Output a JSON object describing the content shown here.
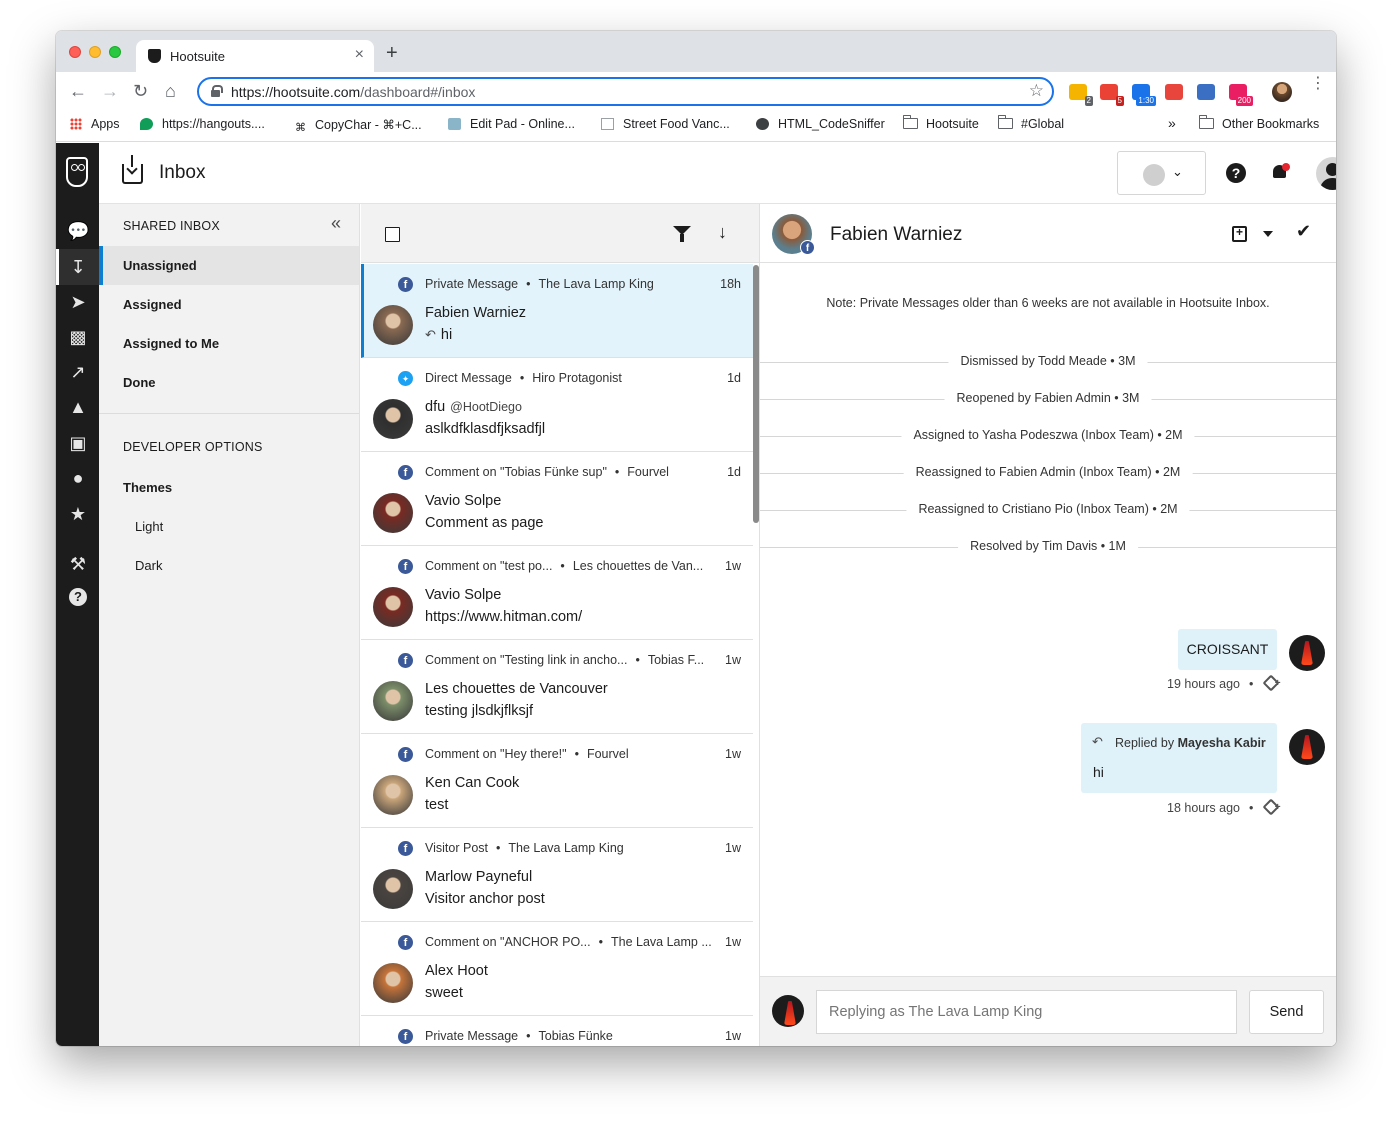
{
  "browser": {
    "tab_title": "Hootsuite",
    "tab_close": "×",
    "new_tab": "+",
    "url_host": "https://hootsuite.com",
    "url_path": "/dashboard#/inbox",
    "extensions": [
      {
        "name": "sticky-notes-ext",
        "color": "#f4b400",
        "badge": "2",
        "badge_color": "#5f6368"
      },
      {
        "name": "gmail-ext",
        "color": "#ea4335",
        "badge": "5",
        "badge_color": "#c5221f"
      },
      {
        "name": "calendar-ext",
        "color": "#1a73e8",
        "badge": "1:30",
        "badge_color": "#1a73e8"
      },
      {
        "name": "timer-ext",
        "color": "#e8453c",
        "badge": "",
        "badge_color": "#e8453c"
      },
      {
        "name": "blue-square-ext",
        "color": "#3b6fc4",
        "badge": "",
        "badge_color": "#3b6fc4"
      },
      {
        "name": "counter-ext",
        "color": "#e91e63",
        "badge": "200",
        "badge_color": "#e91e63"
      }
    ],
    "bookmarks": [
      {
        "label": "Apps",
        "icon": "apps-grid-icon"
      },
      {
        "label": "https://hangouts....",
        "icon": "hangouts-icon"
      },
      {
        "label": "CopyChar - ⌘+C...",
        "icon": "command-icon"
      },
      {
        "label": "Edit Pad - Online...",
        "icon": "notepad-icon"
      },
      {
        "label": "Street Food Vanc...",
        "icon": "cube-icon"
      },
      {
        "label": "HTML_CodeSniffer",
        "icon": "globe-icon"
      },
      {
        "label": "Hootsuite",
        "icon": "folder-icon"
      },
      {
        "label": "#Global",
        "icon": "folder-icon"
      }
    ],
    "overflow": "»",
    "other_bookmarks": "Other Bookmarks"
  },
  "app": {
    "page_title": "Inbox",
    "help": "?",
    "account_chevron": "⌄"
  },
  "sidebar": {
    "heading": "SHARED INBOX",
    "collapse": "«",
    "items": [
      {
        "label": "Unassigned",
        "active": true
      },
      {
        "label": "Assigned",
        "active": false
      },
      {
        "label": "Assigned to Me",
        "active": false
      },
      {
        "label": "Done",
        "active": false
      }
    ],
    "dev_heading": "DEVELOPER OPTIONS",
    "themes_label": "Themes",
    "themes": [
      "Light",
      "Dark"
    ]
  },
  "messages": [
    {
      "network": "facebook",
      "type": "Private Message",
      "source": "The Lava Lamp King",
      "time": "18h",
      "name": "Fabien Warniez",
      "handle": "",
      "text": "hi",
      "replied": true,
      "selected": true,
      "avatar_color": "#8a6a52"
    },
    {
      "network": "twitter",
      "type": "Direct Message",
      "source": "Hiro Protagonist",
      "time": "1d",
      "name": "dfu",
      "handle": "@HootDiego",
      "text": "aslkdfklasdfjksadfjl",
      "replied": false,
      "selected": false,
      "avatar_color": "#2f2f2f"
    },
    {
      "network": "facebook",
      "type": "Comment on \"Tobias Fünke sup\"",
      "source": "Fourvel",
      "time": "1d",
      "name": "Vavio Solpe",
      "handle": "",
      "text": "Comment as page",
      "replied": false,
      "selected": false,
      "avatar_color": "#7a2a22"
    },
    {
      "network": "facebook",
      "type": "Comment on \"test po...",
      "source": "Les chouettes de Van...",
      "time": "1w",
      "name": "Vavio Solpe",
      "handle": "",
      "text": "https://www.hitman.com/",
      "replied": false,
      "selected": false,
      "avatar_color": "#7a2a22"
    },
    {
      "network": "facebook",
      "type": "Comment on \"Testing link in ancho...",
      "source": "Tobias F...",
      "time": "1w",
      "name": "Les chouettes de Vancouver",
      "handle": "",
      "text": "testing jlsdkjflksjf",
      "replied": false,
      "selected": false,
      "avatar_color": "#7d8f6a"
    },
    {
      "network": "facebook",
      "type": "Comment on \"Hey there!\"",
      "source": "Fourvel",
      "time": "1w",
      "name": "Ken Can Cook",
      "handle": "",
      "text": "test",
      "replied": false,
      "selected": false,
      "avatar_color": "#c9a57a"
    },
    {
      "network": "facebook",
      "type": "Visitor Post",
      "source": "The Lava Lamp King",
      "time": "1w",
      "name": "Marlow Payneful",
      "handle": "",
      "text": "Visitor anchor post",
      "replied": false,
      "selected": false,
      "avatar_color": "#4a4440"
    },
    {
      "network": "facebook",
      "type": "Comment on \"ANCHOR PO...",
      "source": "The Lava Lamp ...",
      "time": "1w",
      "name": "Alex Hoot",
      "handle": "",
      "text": "sweet",
      "replied": false,
      "selected": false,
      "avatar_color": "#c7743a"
    },
    {
      "network": "facebook",
      "type": "Private Message",
      "source": "Tobias Fünke",
      "time": "1w",
      "name": "",
      "handle": "",
      "text": "",
      "replied": false,
      "selected": false,
      "avatar_color": "#888888"
    }
  ],
  "conversation": {
    "name": "Fabien Warniez",
    "note": "Note: Private Messages older than 6 weeks are not available in Hootsuite Inbox.",
    "events": [
      "Dismissed by Todd Meade • 3M",
      "Reopened by Fabien Admin • 3M",
      "Assigned to Yasha Podeszwa (Inbox Team) • 2M",
      "Reassigned to Fabien Admin (Inbox Team) • 2M",
      "Reassigned to Cristiano Pio (Inbox Team) • 2M",
      "Resolved by Tim Davis • 1M"
    ],
    "bubble1": {
      "text": "CROISSANT",
      "time": "19 hours ago"
    },
    "bubble2": {
      "replied_prefix": "Replied by",
      "replied_by": "Mayesha Kabir",
      "text": "hi",
      "time": "18 hours ago"
    },
    "dot": "•",
    "composer_placeholder": "Replying as The Lava Lamp King",
    "send_label": "Send"
  }
}
